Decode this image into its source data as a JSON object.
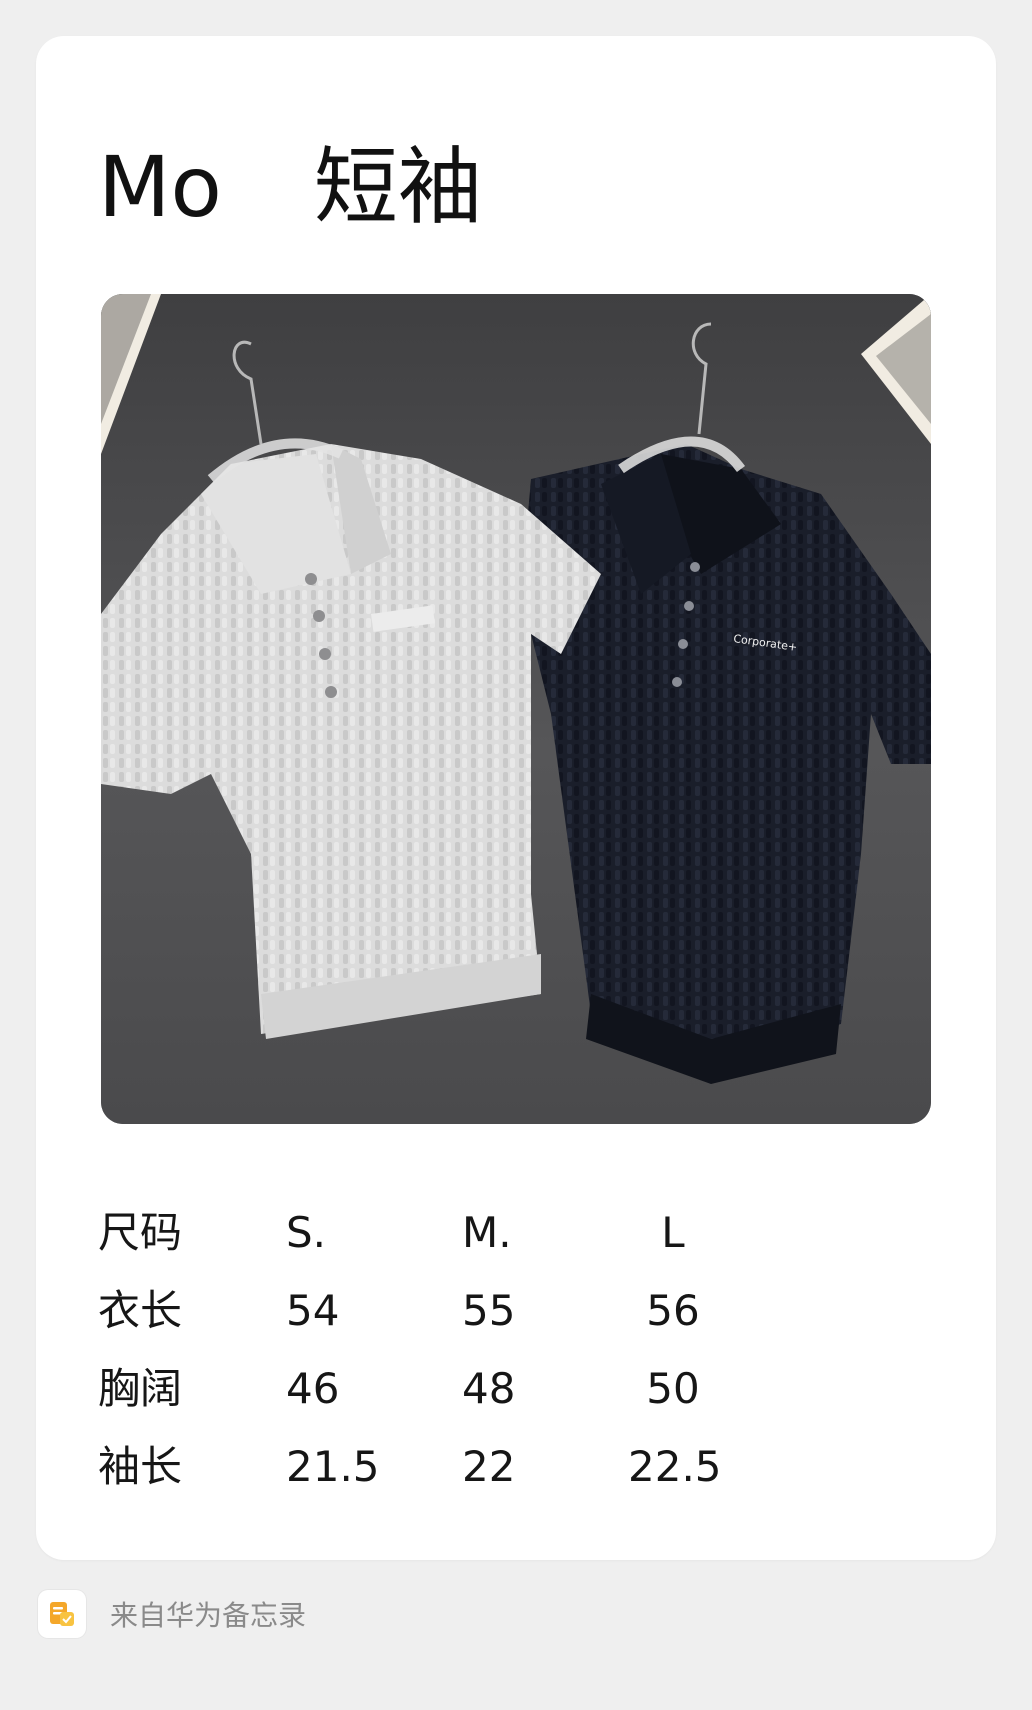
{
  "note": {
    "brand": "Mo",
    "item": "短袖"
  },
  "photo": {
    "logo_text": "Corporate+"
  },
  "size_table": {
    "rows": [
      [
        "尺码",
        "S.",
        "M.",
        "L"
      ],
      [
        "衣长",
        "54",
        "55",
        "56"
      ],
      [
        "胸阔",
        "46",
        "48",
        "50"
      ],
      [
        "袖长",
        "21.5",
        "22",
        "22.5"
      ]
    ]
  },
  "footer": {
    "source": "来自华为备忘录",
    "icon": "memo-app-icon"
  },
  "colors": {
    "background": "#efefef",
    "card": "#ffffff",
    "text": "#161616",
    "footer_text": "#8a8a8a",
    "icon_accent": "#f4a72a"
  }
}
